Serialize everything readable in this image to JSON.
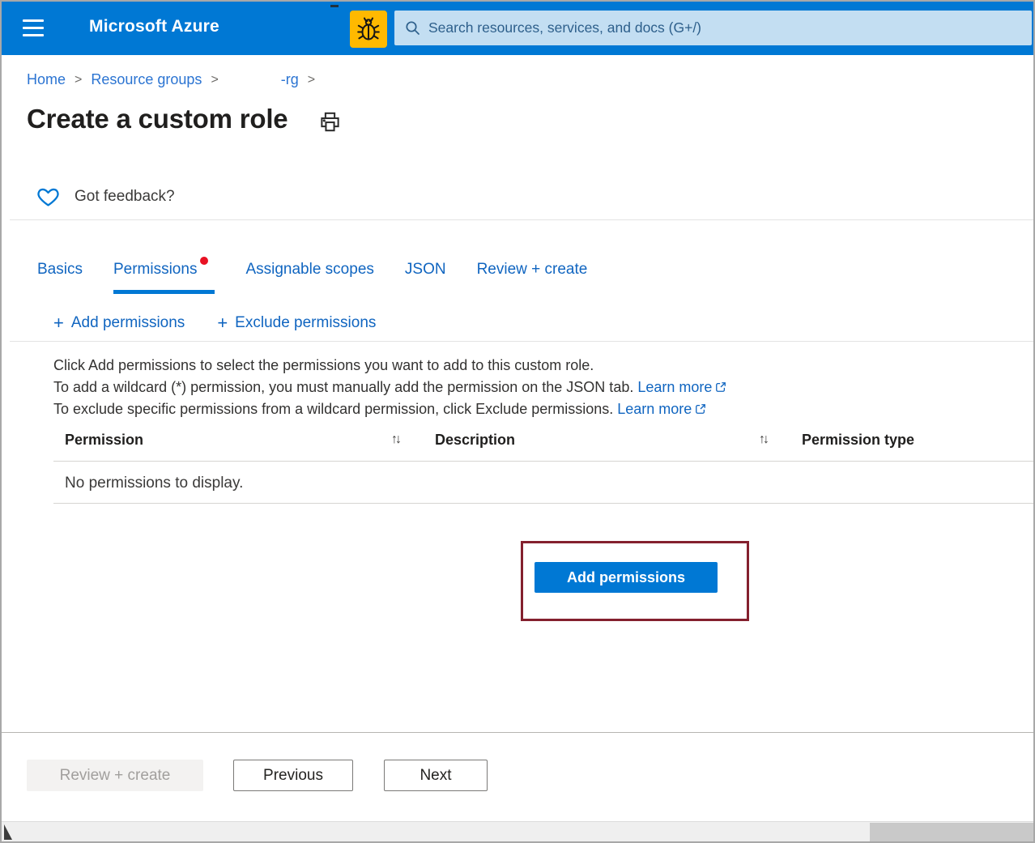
{
  "topbar": {
    "app_title": "Microsoft Azure",
    "search_placeholder": "Search resources, services, and docs (G+/)"
  },
  "breadcrumb": {
    "items": [
      "Home",
      "Resource groups",
      "-rg"
    ],
    "separator": ">"
  },
  "page": {
    "title": "Create a custom role"
  },
  "feedback": {
    "label": "Got feedback?"
  },
  "tabs": [
    {
      "label": "Basics",
      "active": false
    },
    {
      "label": "Permissions",
      "active": true,
      "has_badge": true
    },
    {
      "label": "Assignable scopes",
      "active": false
    },
    {
      "label": "JSON",
      "active": false
    },
    {
      "label": "Review + create",
      "active": false
    }
  ],
  "toolbar": {
    "add_permissions": "Add permissions",
    "exclude_permissions": "Exclude permissions"
  },
  "icons": {
    "plus": "+",
    "sort": "↑↓"
  },
  "instructions": {
    "line1": "Click Add permissions to select the permissions you want to add to this custom role.",
    "line2": "To add a wildcard (*) permission, you must manually add the permission on the JSON tab.",
    "line2_link": "Learn more",
    "line3": "To exclude specific permissions from a wildcard permission, click Exclude permissions.",
    "line3_link": "Learn more"
  },
  "table": {
    "columns": [
      "Permission",
      "Description",
      "Permission type"
    ],
    "empty_message": "No permissions to display."
  },
  "main_action": {
    "label": "Add permissions"
  },
  "footer": {
    "review_create": "Review + create",
    "previous": "Previous",
    "next": "Next"
  },
  "colors": {
    "topbar": "#0078d4",
    "accent": "#0078d4",
    "link": "#1065c0",
    "search_bg": "#c3def2",
    "search_text": "#2d5f8b",
    "bug_bg": "#ffb900",
    "annotation_border": "#84202e",
    "badge_red": "#e81123",
    "disabled_bg": "#f3f2f1",
    "disabled_text": "#a19f9d"
  }
}
